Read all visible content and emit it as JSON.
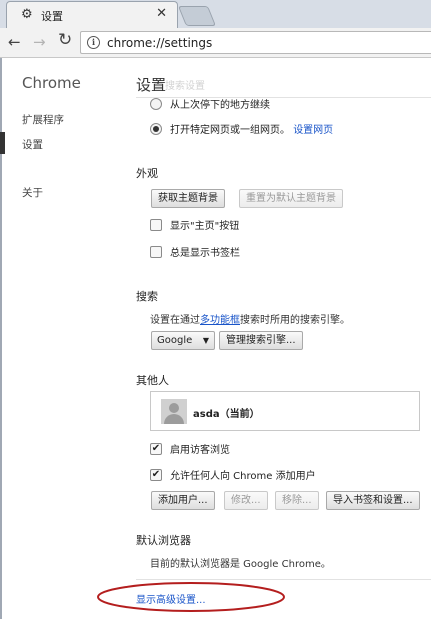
{
  "tab": {
    "title": "设置",
    "icon": "gear-icon",
    "close_icon": "close-icon"
  },
  "toolbar": {
    "url": "chrome://settings"
  },
  "sidebar": {
    "title": "Chrome",
    "items": [
      {
        "label": "扩展程序",
        "active": false
      },
      {
        "label": "设置",
        "active": true
      },
      {
        "label": "关于",
        "active": false
      }
    ]
  },
  "main": {
    "title": "设置",
    "ghost_text": "搜索设置",
    "startup": {
      "opt1": "从上次停下的地方继续",
      "opt2": "打开特定网页或一组网页。",
      "opt2_link": "设置网页"
    },
    "appearance": {
      "title": "外观",
      "get_themes": "获取主题背景",
      "reset_theme": "重置为默认主题背景",
      "show_home": "显示\"主页\"按钮",
      "show_bookmarks": "总是显示书签栏"
    },
    "search": {
      "title": "搜索",
      "desc_pre": "设置在通过",
      "desc_link": "多功能框",
      "desc_post": "搜索时所用的搜索引擎。",
      "engine": "Google",
      "manage": "管理搜索引擎..."
    },
    "people": {
      "title": "其他人",
      "user": "asda（当前）",
      "guest": "启用访客浏览",
      "anyone": "允许任何人向 Chrome 添加用户",
      "add": "添加用户...",
      "edit": "修改...",
      "remove": "移除...",
      "import": "导入书签和设置..."
    },
    "default_browser": {
      "title": "默认浏览器",
      "desc": "目前的默认浏览器是 Google Chrome。"
    },
    "advanced": "显示高级设置..."
  },
  "colors": {
    "link": "#1a55c9",
    "annotation": "#b41e1e"
  }
}
